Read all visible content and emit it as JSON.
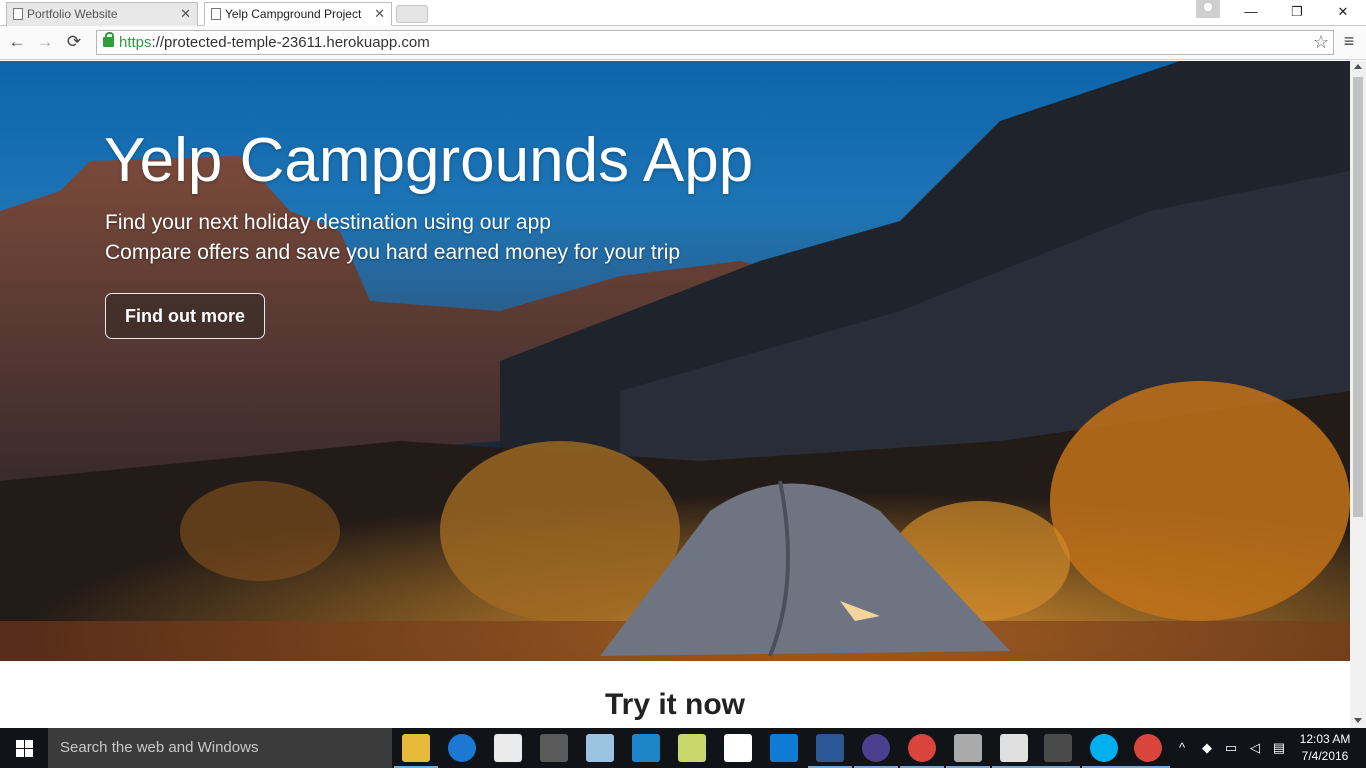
{
  "browser": {
    "tabs": [
      {
        "title": "Portfolio Website",
        "active": false
      },
      {
        "title": "Yelp Campground Project",
        "active": true
      }
    ],
    "url_scheme": "https",
    "url_rest": "://protected-temple-23611.herokuapp.com",
    "window_controls": {
      "minimize": "—",
      "restore": "❐",
      "close": "✕"
    },
    "icons": {
      "back": "arrow-left-icon",
      "forward": "arrow-right-icon",
      "reload": "reload-icon",
      "star": "star-icon",
      "menu": "hamburger-menu-icon",
      "lock": "lock-icon"
    }
  },
  "hero": {
    "title": "Yelp Campgrounds App",
    "line1": "Find your next holiday destination using our app",
    "line2": "Compare offers and save you hard earned money for your trip",
    "button_label": "Find out more"
  },
  "section": {
    "try_title": "Try it now"
  },
  "taskbar": {
    "search_placeholder": "Search the web and Windows",
    "time": "12:03 AM",
    "date": "7/4/2016",
    "apps": [
      "file-explorer-icon",
      "edge-icon",
      "store-icon",
      "calculator-icon",
      "app-icon",
      "app-icon",
      "app-icon",
      "dropbox-icon",
      "app-icon",
      "word-icon",
      "eclipse-icon",
      "chrome-icon",
      "app-icon",
      "app-icon",
      "sublime-icon",
      "skype-icon",
      "chrome-icon"
    ]
  },
  "colors": {
    "accent": "#2e9f3a",
    "taskbar": "#101418",
    "sky": "#1d74b5"
  }
}
